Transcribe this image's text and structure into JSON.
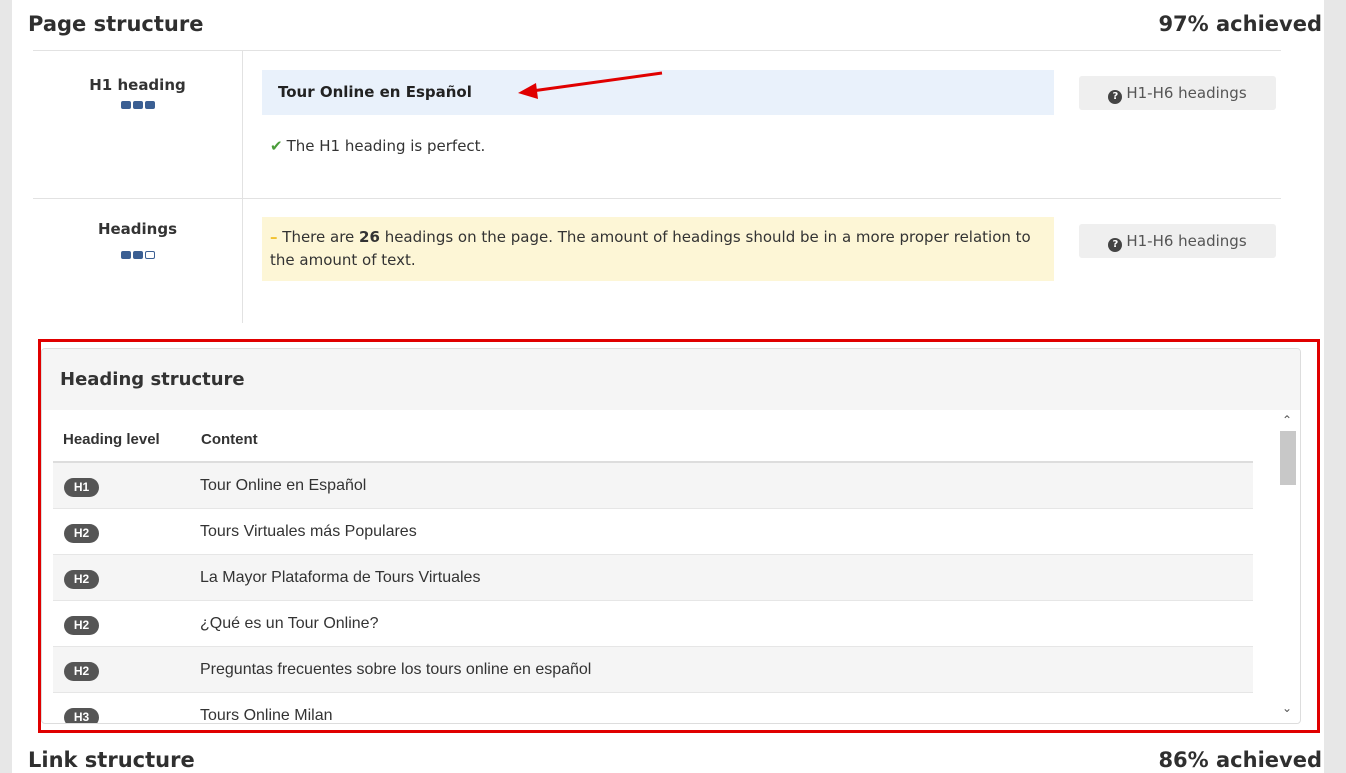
{
  "page_structure": {
    "title": "Page structure",
    "score": "97% achieved",
    "h1_heading": {
      "label": "H1 heading",
      "rating_filled": 3,
      "value": "Tour Online en Español",
      "status": "The H1 heading is perfect.",
      "help": "H1-H6 headings"
    },
    "headings": {
      "label": "Headings",
      "rating_filled": 2,
      "msg_pre": "There are ",
      "msg_count": "26",
      "msg_post": " headings on the page. The amount of headings should be in a more proper relation to the amount of text.",
      "help": "H1-H6 headings"
    }
  },
  "heading_structure": {
    "title": "Heading structure",
    "col_level": "Heading level",
    "col_content": "Content",
    "rows": [
      {
        "level": "H1",
        "content": "Tour Online en Español"
      },
      {
        "level": "H2",
        "content": "Tours Virtuales más Populares"
      },
      {
        "level": "H2",
        "content": "La Mayor Plataforma de Tours Virtuales"
      },
      {
        "level": "H2",
        "content": "¿Qué es un Tour Online?"
      },
      {
        "level": "H2",
        "content": "Preguntas frecuentes sobre los tours online en español"
      },
      {
        "level": "H3",
        "content": "Tours Online Milan"
      }
    ]
  },
  "link_structure": {
    "title": "Link structure",
    "score": "86% achieved"
  },
  "colors": {
    "highlight_box": "#e00000",
    "rating": "#3b5f93",
    "warning_bg": "#fdf6d6",
    "info_bg": "#e9f1fb",
    "ok": "#4a9c3a"
  }
}
